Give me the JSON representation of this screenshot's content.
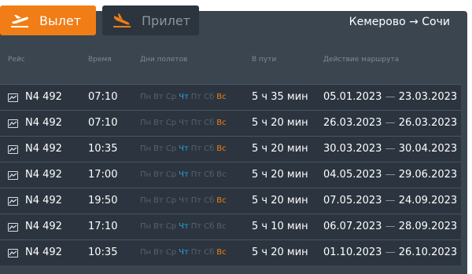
{
  "tabs": {
    "depart": {
      "label": "Вылет",
      "icon": "plane-departure-icon"
    },
    "arrive": {
      "label": "Прилет",
      "icon": "plane-arrival-icon"
    }
  },
  "route": "Кемерово → Сочи",
  "columns": {
    "flight": "Рейс",
    "time": "Время",
    "days": "Дни полетов",
    "duration": "В пути",
    "period": "Действие маршрута"
  },
  "day_names": [
    "Пн",
    "Вт",
    "Ср",
    "Чт",
    "Пт",
    "Сб",
    "Вс"
  ],
  "colors": {
    "accent": "#f07d15",
    "thursday": "#2a9fe0",
    "sunday": "#f07d15",
    "inactive": "#55616b"
  },
  "flights": [
    {
      "number": "N4 492",
      "time": "07:10",
      "active_days": [
        "Чт",
        "Вс"
      ],
      "duration": "5 ч 35 мин",
      "from": "05.01.2023",
      "sep": "—",
      "to": "23.03.2023"
    },
    {
      "number": "N4 492",
      "time": "07:10",
      "active_days": [
        "Вс"
      ],
      "duration": "5 ч 20 мин",
      "from": "26.03.2023",
      "sep": "—",
      "to": "26.03.2023"
    },
    {
      "number": "N4 492",
      "time": "10:35",
      "active_days": [
        "Чт",
        "Вс"
      ],
      "duration": "5 ч 20 мин",
      "from": "30.03.2023",
      "sep": "—",
      "to": "30.04.2023"
    },
    {
      "number": "N4 492",
      "time": "17:00",
      "active_days": [
        "Чт"
      ],
      "duration": "5 ч 20 мин",
      "from": "04.05.2023",
      "sep": "—",
      "to": "29.06.2023"
    },
    {
      "number": "N4 492",
      "time": "19:50",
      "active_days": [
        "Вс"
      ],
      "duration": "5 ч 20 мин",
      "from": "07.05.2023",
      "sep": "—",
      "to": "24.09.2023"
    },
    {
      "number": "N4 492",
      "time": "17:10",
      "active_days": [
        "Чт"
      ],
      "duration": "5 ч 10 мин",
      "from": "06.07.2023",
      "sep": "—",
      "to": "28.09.2023"
    },
    {
      "number": "N4 492",
      "time": "10:35",
      "active_days": [
        "Чт",
        "Вс"
      ],
      "duration": "5 ч 20 мин",
      "from": "01.10.2023",
      "sep": "—",
      "to": "26.10.2023"
    }
  ]
}
